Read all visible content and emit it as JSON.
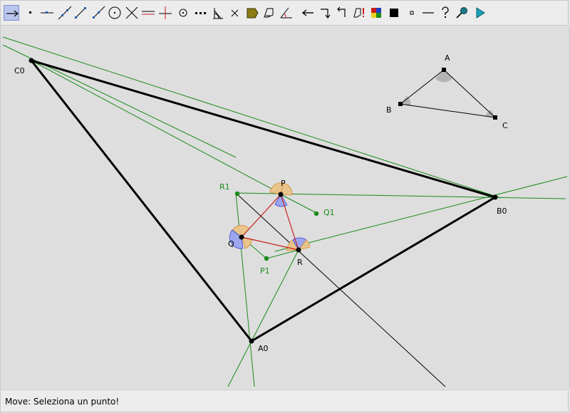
{
  "toolbar": {
    "tools": [
      {
        "icon": "move-arrow-icon",
        "active": true
      },
      {
        "icon": "point-icon"
      },
      {
        "icon": "point-on-line-icon"
      },
      {
        "icon": "line-icon"
      },
      {
        "icon": "segment-icon"
      },
      {
        "icon": "ray-icon"
      },
      {
        "icon": "circle-icon"
      },
      {
        "icon": "intersection-icon"
      },
      {
        "icon": "parallel-icon"
      },
      {
        "icon": "perpendicular-icon"
      },
      {
        "icon": "midpoint-icon"
      },
      {
        "icon": "dotted-line-icon"
      },
      {
        "icon": "compass-icon"
      },
      {
        "icon": "delete-icon"
      },
      {
        "icon": "polygon-icon"
      },
      {
        "icon": "locus-icon"
      },
      {
        "icon": "angle-icon"
      },
      {
        "icon": "undo-arrow-icon"
      },
      {
        "icon": "macro-record-icon"
      },
      {
        "icon": "macro-play-icon"
      },
      {
        "icon": "macro-alert-icon"
      },
      {
        "icon": "color-palette-icon"
      },
      {
        "icon": "filled-square-icon"
      },
      {
        "icon": "small-square-icon"
      },
      {
        "icon": "line-style-icon"
      },
      {
        "icon": "help-icon"
      },
      {
        "icon": "magnifier-icon"
      },
      {
        "icon": "run-icon"
      }
    ]
  },
  "geometry": {
    "labels": {
      "A": "A",
      "B": "B",
      "C": "C",
      "A0": "A0",
      "B0": "B0",
      "C0": "C0",
      "P": "P",
      "Q": "Q",
      "R": "R",
      "P1": "P1",
      "Q1": "Q1",
      "R1": "R1"
    },
    "colors": {
      "black": "#000000",
      "green": "#1a8a1a",
      "red": "#c81e1e",
      "angle_orange": "#e8c48a",
      "angle_blue": "#9ba6ee",
      "angle_gray": "#b4b4b4"
    }
  },
  "status": {
    "text": "Move: Seleziona un punto!"
  }
}
